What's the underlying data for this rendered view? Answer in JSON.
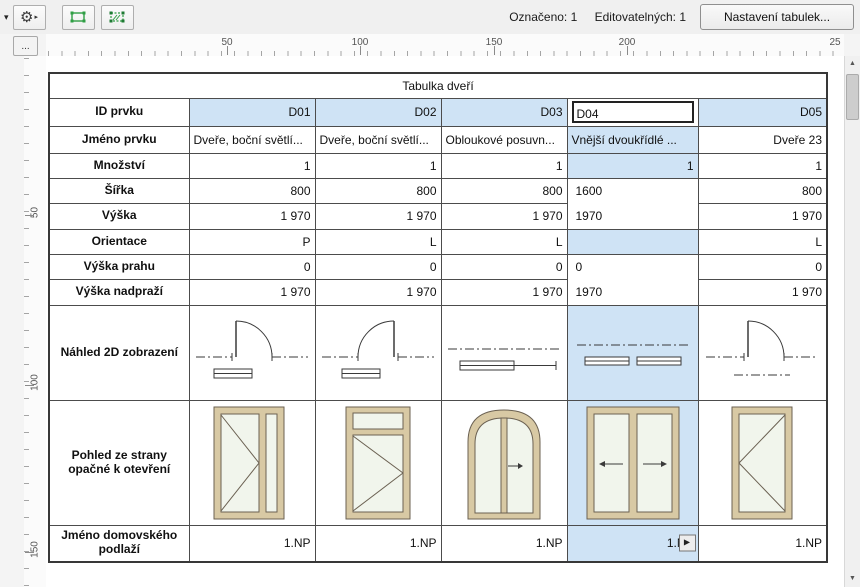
{
  "toolbar": {
    "caret_glyph": "▾",
    "gear_glyph": "⚙",
    "gear_flyout_glyph": "▸",
    "icons": [
      "dropdown-caret",
      "scheme-settings-gear",
      "highlight-selection",
      "select-on-plan"
    ],
    "status": {
      "selected": "Označeno: 1",
      "editable": "Editovatelných: 1"
    },
    "settings_button": "Nastavení tabulek..."
  },
  "rulers": {
    "corner": "...",
    "horizontal": [
      "50",
      "100",
      "150",
      "200",
      "25"
    ],
    "vertical": [
      "50",
      "100",
      "150"
    ]
  },
  "scrollbar": {
    "up_glyph": "▲",
    "down_glyph": "▼"
  },
  "schedule": {
    "title": "Tabulka dveří",
    "flyout_glyph": "▶",
    "row_headers": [
      "ID prvku",
      "Jméno prvku",
      "Množství",
      "Šířka",
      "Výška",
      "Orientace",
      "Výška prahu",
      "Výška nadpraží",
      "Náhled 2D zobrazení",
      "Pohled ze strany opačné k otevření",
      "Jméno domovského podlaží"
    ],
    "columns": [
      {
        "id": "D01",
        "name": "Dveře, boční světlí...",
        "qty": "1",
        "width": "800",
        "height": "1 970",
        "orientation": "P",
        "sill": "0",
        "lintel": "1 970",
        "floor": "1.NP",
        "preview_2d": "hinged-door-right-swing",
        "elevation": "door-with-sidelight"
      },
      {
        "id": "D02",
        "name": "Dveře, boční světlí...",
        "qty": "1",
        "width": "800",
        "height": "1 970",
        "orientation": "L",
        "sill": "0",
        "lintel": "1 970",
        "floor": "1.NP",
        "preview_2d": "hinged-door-left-swing",
        "elevation": "door-with-transom"
      },
      {
        "id": "D03",
        "name": "Obloukové posuvn...",
        "qty": "1",
        "width": "800",
        "height": "1 970",
        "orientation": "L",
        "sill": "0",
        "lintel": "1 970",
        "floor": "1.NP",
        "preview_2d": "sliding-door",
        "elevation": "arched-double-door"
      },
      {
        "id": "D04",
        "name": "Vnější dvoukřídlé ...",
        "qty": "1",
        "width": "1600",
        "height": "1970",
        "orientation": "",
        "sill": "0",
        "lintel": "1970",
        "floor": "1.NP",
        "preview_2d": "double-sliding-door",
        "elevation": "double-door",
        "selected": true
      },
      {
        "id": "D05",
        "name": "Dveře 23",
        "qty": "1",
        "width": "800",
        "height": "1 970",
        "orientation": "L",
        "sill": "0",
        "lintel": "1 970",
        "floor": "1.NP",
        "preview_2d": "hinged-door-right-swing",
        "elevation": "single-door"
      }
    ]
  },
  "colors": {
    "selection_blue": "#cfe3f5",
    "frame_beige": "#d8c9a4",
    "toolbar_green": "#2f9e44"
  }
}
